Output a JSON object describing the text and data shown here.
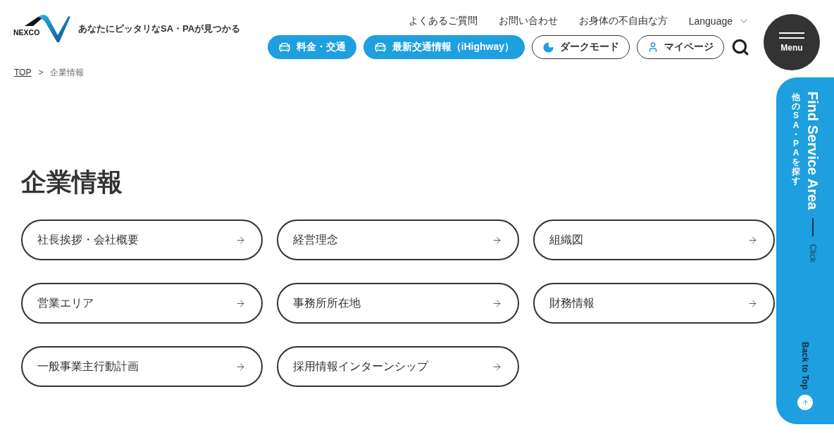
{
  "header": {
    "logo": "NEXCO",
    "tagline": "あなたにピッタリなSA・PAが見つかる",
    "top_links": [
      "よくあるご質問",
      "お問い合わせ",
      "お身体の不自由な方"
    ],
    "language": "Language",
    "buttons": [
      {
        "kind": "route",
        "label": "料金・交通"
      },
      {
        "kind": "route",
        "label": "最新交通情報（iHighway）"
      },
      {
        "kind": "mode",
        "label": "ダークモード"
      },
      {
        "kind": "account",
        "label": "マイページ"
      }
    ],
    "menu": "Menu"
  },
  "breadcrumb": {
    "items": [
      {
        "label": "TOP",
        "current": false
      },
      {
        "label": "企業情報",
        "current": true
      }
    ],
    "separator": ">"
  },
  "page_title": "企業情報",
  "links": [
    "社長挨拶・会社概要",
    "経営理念",
    "組織図",
    "営業エリア",
    "事務所所在地",
    "財務情報",
    "一般事業主行動計画",
    "採用情報インターンシップ"
  ],
  "side_panel": {
    "title": "Find Service Area",
    "subtitle": "他のSA・PAを探す",
    "action": "Click",
    "back_to_top": "Back to Top"
  }
}
